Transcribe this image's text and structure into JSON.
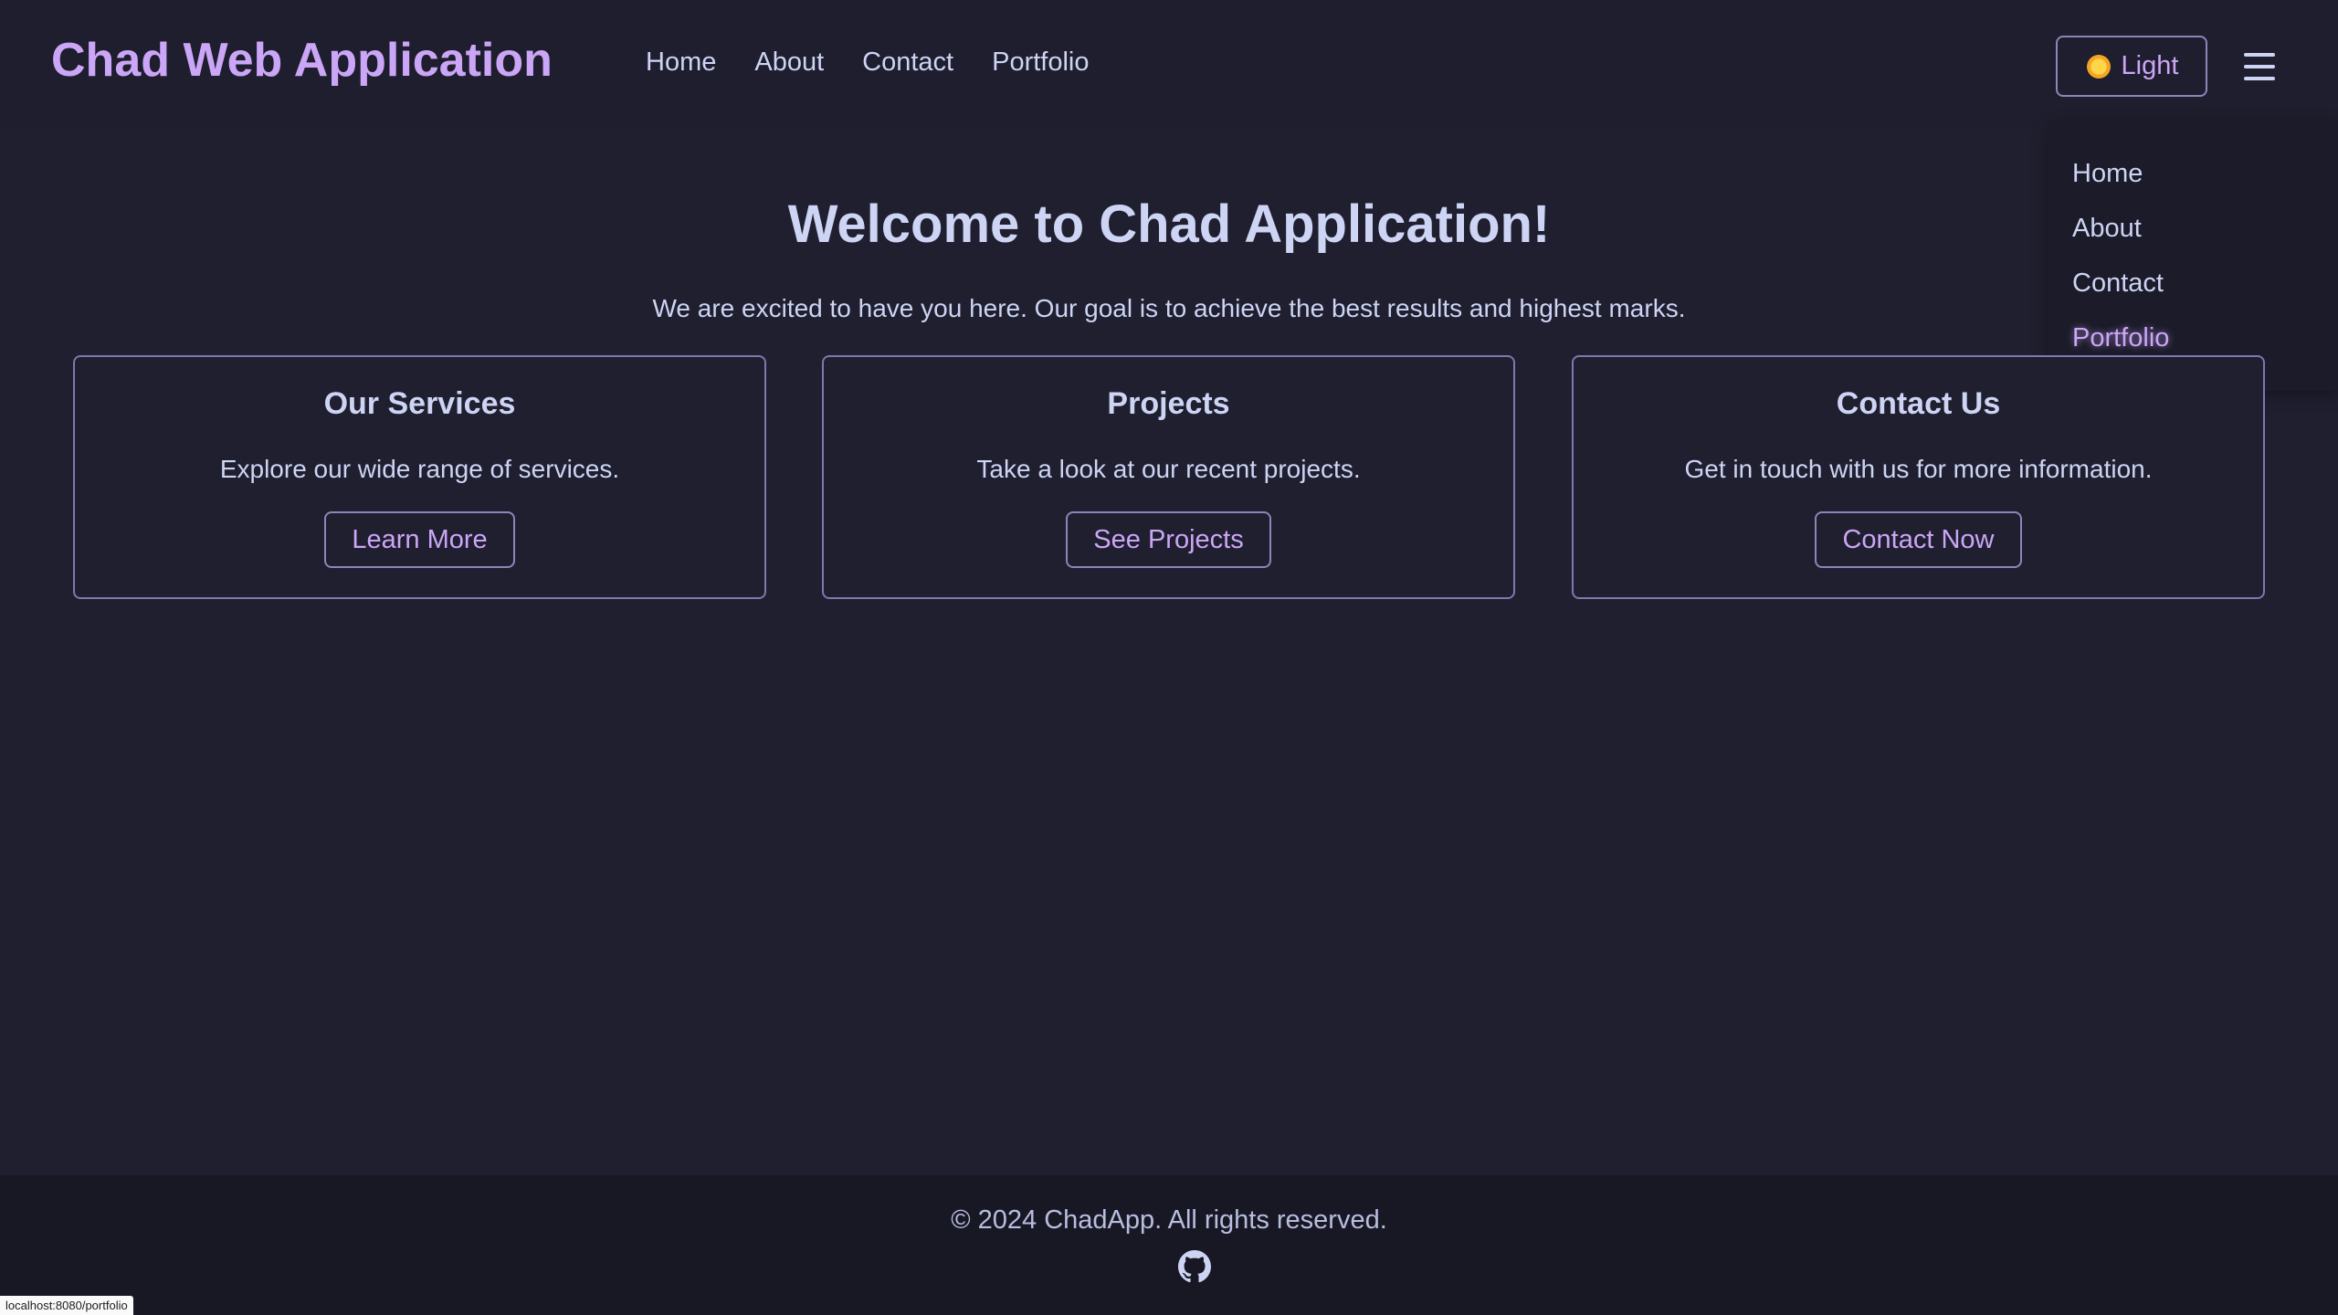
{
  "header": {
    "brand": "Chad Web Application",
    "nav": [
      {
        "label": "Home"
      },
      {
        "label": "About"
      },
      {
        "label": "Contact"
      },
      {
        "label": "Portfolio"
      }
    ],
    "theme_toggle": {
      "label": "Light",
      "icon": "sun-icon"
    },
    "menu_icon": "hamburger-menu-icon"
  },
  "dropdown": {
    "items": [
      {
        "label": "Home"
      },
      {
        "label": "About"
      },
      {
        "label": "Contact"
      },
      {
        "label": "Portfolio"
      }
    ],
    "active": "Portfolio"
  },
  "hero": {
    "title": "Welcome to Chad Application!",
    "subtitle": "We are excited to have you here. Our goal is to achieve the best results and highest marks."
  },
  "cards": [
    {
      "title": "Our Services",
      "text": "Explore our wide range of services.",
      "button": "Learn More"
    },
    {
      "title": "Projects",
      "text": "Take a look at our recent projects.",
      "button": "See Projects"
    },
    {
      "title": "Contact Us",
      "text": "Get in touch with us for more information.",
      "button": "Contact Now"
    }
  ],
  "footer": {
    "text": "© 2024 ChadApp. All rights reserved.",
    "icon": "github-icon"
  },
  "status_bar": {
    "url": "localhost:8080/portfolio"
  },
  "colors": {
    "background": "#1f1f2f",
    "accent": "#cba6f7",
    "text": "#cdd4f4",
    "footer_bg": "#181825"
  }
}
